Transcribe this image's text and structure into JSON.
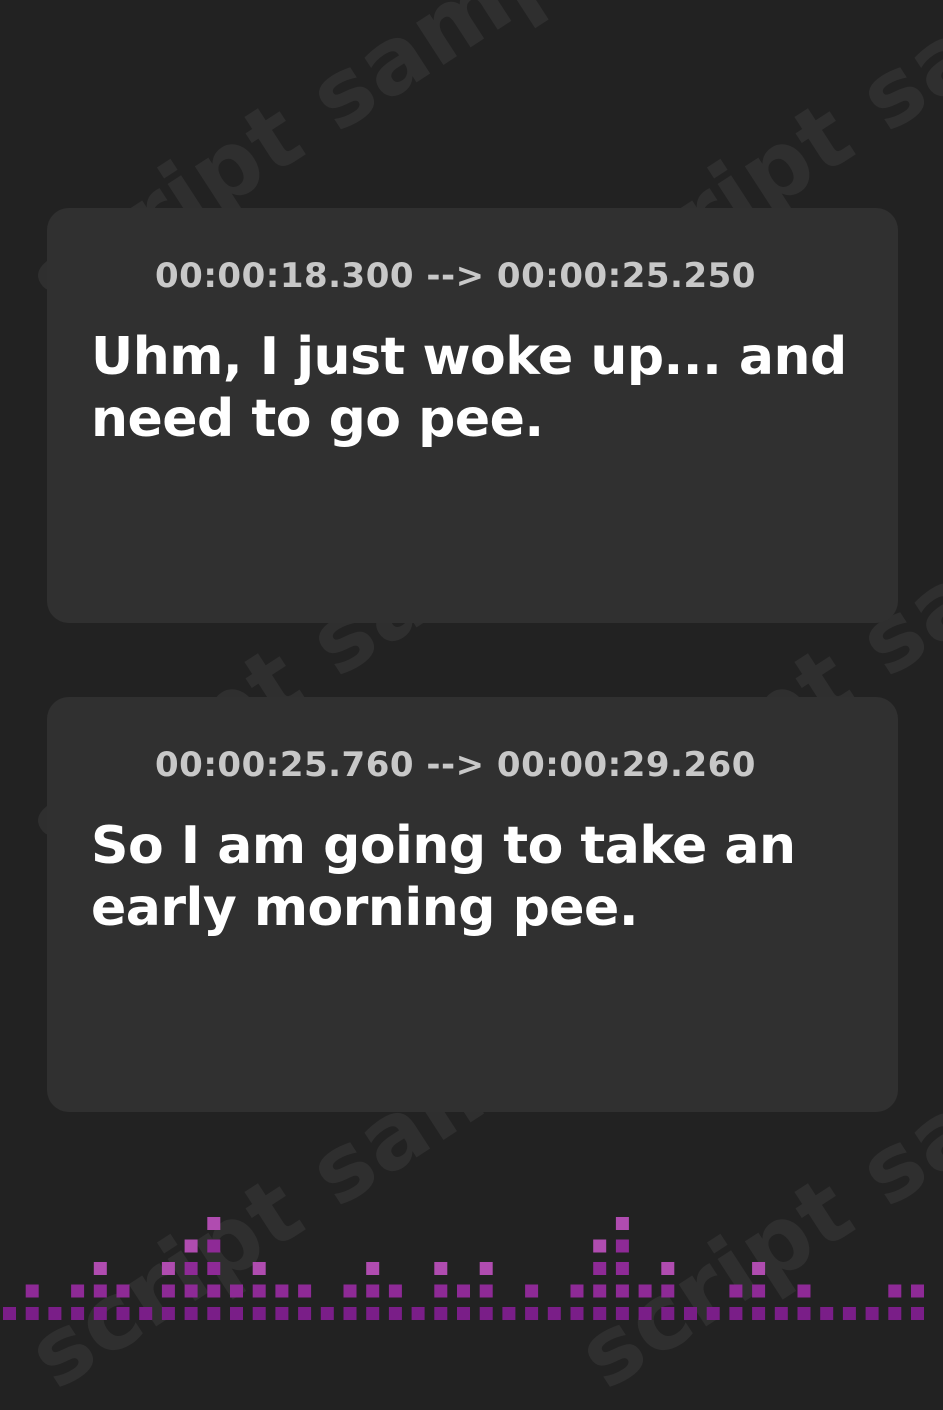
{
  "watermark": {
    "text": "script sample"
  },
  "cues": [
    {
      "timing": "00:00:18.300 --> 00:00:25.250",
      "text": "Uhm, I just woke up... and need to go pee."
    },
    {
      "timing": "00:00:25.760 --> 00:00:29.260",
      "text": "So I am going to take an early morning pee."
    }
  ],
  "icons": {
    "cue_icon": "audio-waveform-icon",
    "footer": "equalizer-bars-decoration"
  },
  "colors": {
    "background": "#222222",
    "card": "#303030",
    "accent_magenta": "#c040c0",
    "accent_purple": "#8a2a9a"
  }
}
